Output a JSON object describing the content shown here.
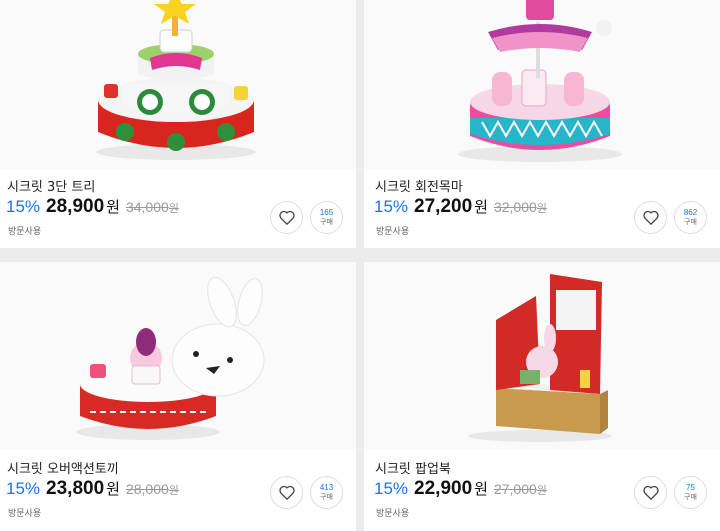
{
  "products": [
    {
      "title": "시크릿 3단 트리",
      "discount": "15%",
      "price": "28,900",
      "currency": "원",
      "original_price": "34,000",
      "original_currency": "원",
      "note": "방문사용",
      "purchases": "165",
      "purchases_label": "구매"
    },
    {
      "title": "시크릿 회전목마",
      "discount": "15%",
      "price": "27,200",
      "currency": "원",
      "original_price": "32,000",
      "original_currency": "원",
      "note": "방문사용",
      "purchases": "862",
      "purchases_label": "구매"
    },
    {
      "title": "시크릿 오버액션토끼",
      "discount": "15%",
      "price": "23,800",
      "currency": "원",
      "original_price": "28,000",
      "original_currency": "원",
      "note": "방문사용",
      "purchases": "413",
      "purchases_label": "구매"
    },
    {
      "title": "시크릿 팝업북",
      "discount": "15%",
      "price": "22,900",
      "currency": "원",
      "original_price": "27,000",
      "original_currency": "원",
      "note": "방문사용",
      "purchases": "75",
      "purchases_label": "구매"
    }
  ],
  "colors": {
    "discount": "#1a73e8",
    "background": "#ececec",
    "card": "#ffffff"
  },
  "icons": {
    "wishlist": "heart-icon"
  }
}
